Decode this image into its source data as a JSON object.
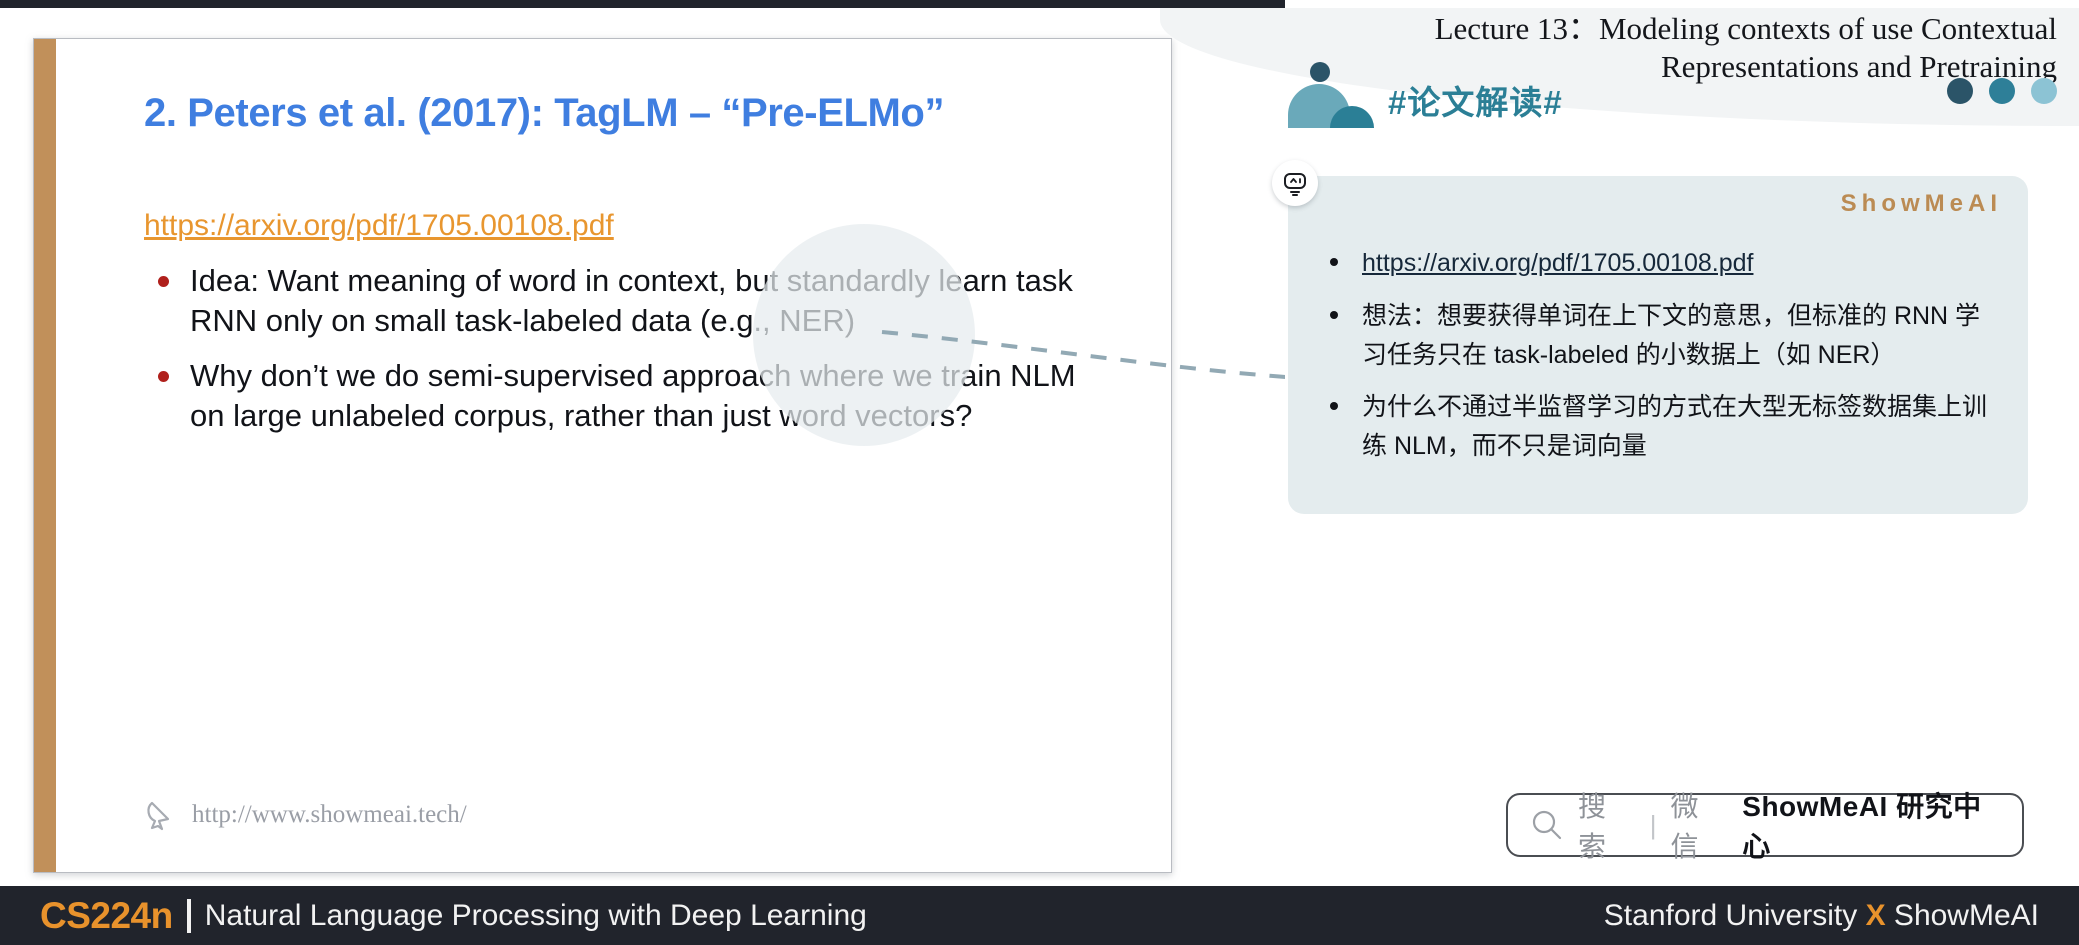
{
  "slide": {
    "title": "2. Peters et al. (2017): TagLM – “Pre-ELMo”",
    "link": "https://arxiv.org/pdf/1705.00108.pdf",
    "bullets": [
      "Idea: Want meaning of word in context, but standardly learn task RNN only on small task-labeled data (e.g., NER)",
      "Why don’t we do semi-supervised approach where we train NLM on large unlabeled corpus, rather than just word vectors?"
    ],
    "watermark": "http://www.showmeai.tech/",
    "accent_color": "#c1905a",
    "title_color": "#3f7ee0",
    "link_color": "#e8962f",
    "bullet_marker_color": "#b0201c"
  },
  "header": {
    "lecture_title_line1": "Lecture 13：Modeling contexts of use Contextual",
    "lecture_title_line2": "Representations and Pretraining",
    "dots": [
      "#2b5468",
      "#2e7f98",
      "#8cc3d4"
    ],
    "tag": "#论文解读#",
    "tag_color": "#2b7f96"
  },
  "note_card": {
    "brand": "ShowMeAI",
    "brand_color": "#bb8b53",
    "background": "#e4ecee",
    "avatar_icon": "robot-face-icon",
    "items": [
      {
        "type": "link",
        "text": "https://arxiv.org/pdf/1705.00108.pdf"
      },
      {
        "type": "text",
        "text": "想法：想要获得单词在上下文的意思，但标准的 RNN 学习任务只在 task-labeled 的小数据上（如 NER）"
      },
      {
        "type": "text",
        "text": "为什么不通过半监督学习的方式在大型无标签数据集上训练 NLM，而不只是词向量"
      }
    ]
  },
  "search_pill": {
    "icon": "search-icon",
    "placeholder": "搜索",
    "divider": "|",
    "channel": "微信",
    "account": "ShowMeAI 研究中心"
  },
  "footer": {
    "course_code": "CS224n",
    "course_name": "Natural Language Processing with Deep Learning",
    "right_prefix": "Stanford University ",
    "right_x": "X",
    "right_suffix": " ShowMeAI",
    "bg": "#21242c",
    "accent": "#e8922c"
  }
}
